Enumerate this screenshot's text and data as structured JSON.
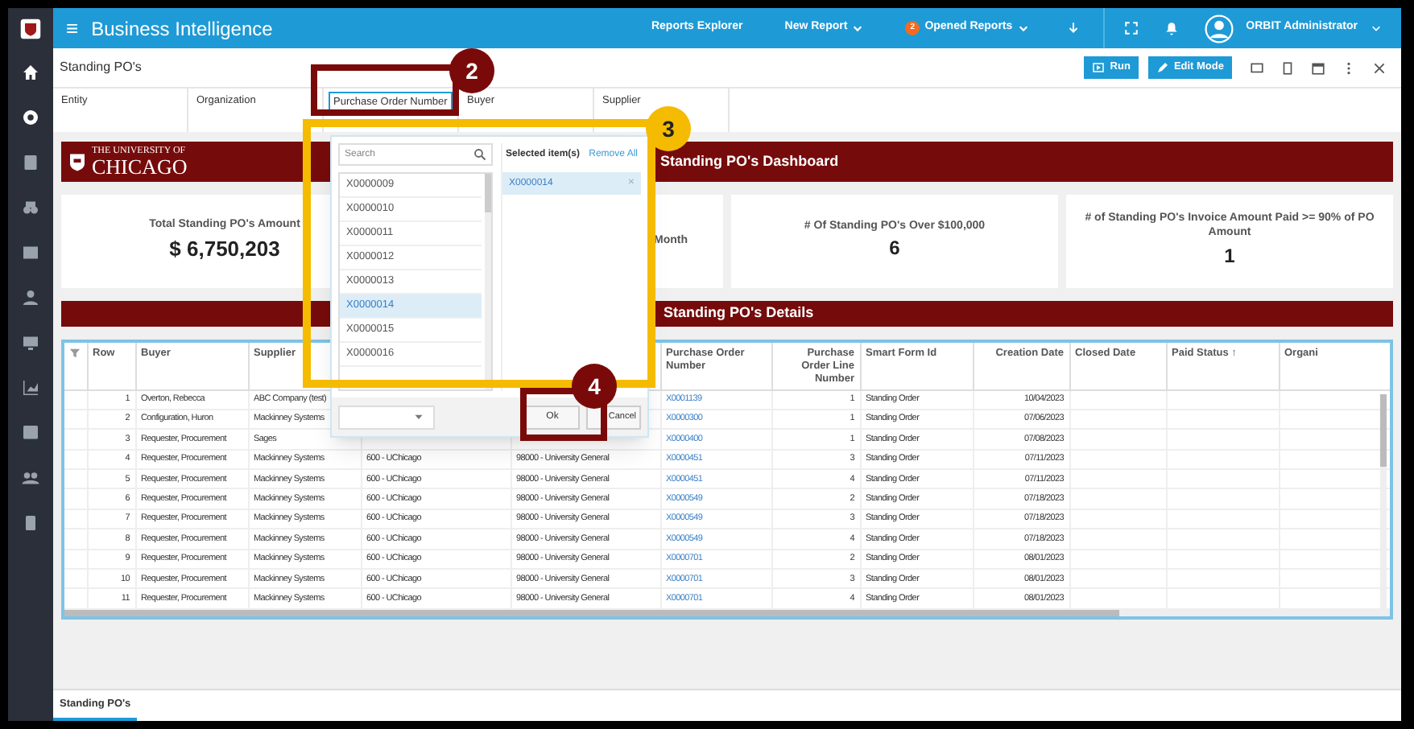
{
  "app": {
    "title": "Business Intelligence",
    "menu_icon": "≡",
    "nav": [
      {
        "label": "Reports Explorer",
        "dropdown": false
      },
      {
        "label": "New Report",
        "dropdown": true
      },
      {
        "label": "Opened Reports",
        "dropdown": true,
        "badge": "2"
      }
    ],
    "user": "ORBIT Administrator"
  },
  "report": {
    "title": "Standing PO's",
    "buttons": [
      "Run",
      "Edit Mode"
    ]
  },
  "filters": [
    {
      "label": "Entity",
      "selected": false
    },
    {
      "label": "Organization",
      "selected": false
    },
    {
      "label": "Purchase Order Number",
      "selected": true
    },
    {
      "label": "Buyer",
      "selected": false
    },
    {
      "label": "Supplier",
      "selected": false
    }
  ],
  "banner": {
    "logo_line_1": "THE UNIVERSITY OF",
    "logo_line_2": "CHICAGO",
    "title": "Standing PO's Dashboard"
  },
  "kpis": [
    {
      "title": "Total Standing PO's Amount",
      "value": "$ 6,750,203"
    },
    {
      "title": "Month"
    },
    {
      "title": "# Of Standing PO's Over $100,000",
      "value": "6"
    },
    {
      "title": "# of Standing PO's Invoice Amount Paid >= 90% of PO Amount",
      "value": "1"
    }
  ],
  "details_title": "Standing PO's Details",
  "table": {
    "columns": [
      "",
      "Row",
      "Buyer",
      "Supplier",
      "",
      "",
      "Purchase Order Number",
      "Purchase Order Line Number",
      "Smart Form Id",
      "Creation Date",
      "Closed Date",
      "Paid Status ↑",
      "Organi"
    ],
    "rows": [
      [
        "",
        "1",
        "Overton, Rebecca",
        "ABC Company (test)",
        "",
        "",
        "X0001139",
        "1",
        "Standing Order",
        "10/04/2023",
        "",
        "",
        ""
      ],
      [
        "",
        "2",
        "Configuration, Huron",
        "Mackinney Systems",
        "",
        "",
        "X0000300",
        "1",
        "Standing Order",
        "07/06/2023",
        "",
        "",
        ""
      ],
      [
        "",
        "3",
        "Requester, Procurement",
        "Sages",
        "",
        "",
        "X0000400",
        "1",
        "Standing Order",
        "07/08/2023",
        "",
        "",
        ""
      ],
      [
        "",
        "4",
        "Requester, Procurement",
        "Mackinney Systems",
        "600 - UChicago",
        "98000 - University General",
        "X0000451",
        "3",
        "Standing Order",
        "07/11/2023",
        "",
        "",
        ""
      ],
      [
        "",
        "5",
        "Requester, Procurement",
        "Mackinney Systems",
        "600 - UChicago",
        "98000 - University General",
        "X0000451",
        "4",
        "Standing Order",
        "07/11/2023",
        "",
        "",
        ""
      ],
      [
        "",
        "6",
        "Requester, Procurement",
        "Mackinney Systems",
        "600 - UChicago",
        "98000 - University General",
        "X0000549",
        "2",
        "Standing Order",
        "07/18/2023",
        "",
        "",
        ""
      ],
      [
        "",
        "7",
        "Requester, Procurement",
        "Mackinney Systems",
        "600 - UChicago",
        "98000 - University General",
        "X0000549",
        "3",
        "Standing Order",
        "07/18/2023",
        "",
        "",
        ""
      ],
      [
        "",
        "8",
        "Requester, Procurement",
        "Mackinney Systems",
        "600 - UChicago",
        "98000 - University General",
        "X0000549",
        "4",
        "Standing Order",
        "07/18/2023",
        "",
        "",
        ""
      ],
      [
        "",
        "9",
        "Requester, Procurement",
        "Mackinney Systems",
        "600 - UChicago",
        "98000 - University General",
        "X0000701",
        "2",
        "Standing Order",
        "08/01/2023",
        "",
        "",
        ""
      ],
      [
        "",
        "10",
        "Requester, Procurement",
        "Mackinney Systems",
        "600 - UChicago",
        "98000 - University General",
        "X0000701",
        "3",
        "Standing Order",
        "08/01/2023",
        "",
        "",
        ""
      ],
      [
        "",
        "11",
        "Requester, Procurement",
        "Mackinney Systems",
        "600 - UChicago",
        "98000 - University General",
        "X0000701",
        "4",
        "Standing Order",
        "08/01/2023",
        "",
        "",
        ""
      ]
    ]
  },
  "popup": {
    "search_placeholder": "Search",
    "items": [
      {
        "label": "X0000009",
        "selected": false
      },
      {
        "label": "X0000010",
        "selected": false
      },
      {
        "label": "X0000011",
        "selected": false
      },
      {
        "label": "X0000012",
        "selected": false
      },
      {
        "label": "X0000013",
        "selected": false
      },
      {
        "label": "X0000014",
        "selected": true
      },
      {
        "label": "X0000015",
        "selected": false
      },
      {
        "label": "X0000016",
        "selected": false
      }
    ],
    "selected_heading": "Selected item(s)",
    "remove_all": "Remove All",
    "selected_items": [
      "X0000014"
    ],
    "remove_mark": "×",
    "ok": "Ok",
    "cancel": "Cancel"
  },
  "bottom_tabs": [
    {
      "label": "Standing PO's",
      "selected": true
    }
  ],
  "annotations": [
    {
      "label": "2",
      "color": "#7a0a0a"
    },
    {
      "label": "3",
      "color": "#f5bb00"
    },
    {
      "label": "4",
      "color": "#7a0a0a"
    }
  ]
}
